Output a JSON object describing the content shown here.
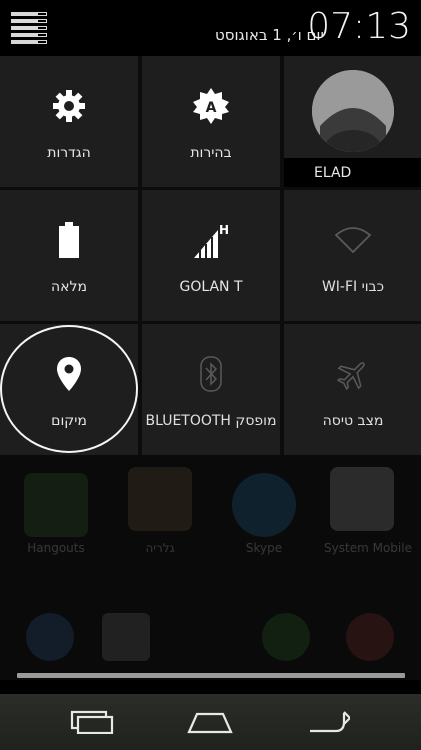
{
  "status": {
    "time": "07:13",
    "date": "יום ו׳, 1 באוגוסט"
  },
  "tiles": {
    "settings": {
      "label": "הגדרות",
      "icon": "gear-icon"
    },
    "brightness": {
      "label": "בהירות",
      "icon": "auto-brightness-icon"
    },
    "user": {
      "name": "ELAD",
      "icon": "avatar-icon"
    },
    "battery": {
      "label": "מלאה",
      "icon": "battery-icon"
    },
    "mobile": {
      "label": "GOLAN T",
      "icon": "signal-icon",
      "badge": "H"
    },
    "wifi": {
      "label": "WI-FI כבוי",
      "icon": "wifi-icon"
    },
    "location": {
      "label": "מיקום",
      "icon": "location-pin-icon"
    },
    "bluetooth": {
      "label": "BLUETOOTH מופסק",
      "icon": "bluetooth-icon"
    },
    "airplane": {
      "label": "מצב טיסה",
      "icon": "airplane-icon"
    }
  },
  "homescreen": {
    "apps": [
      {
        "label": "Hangouts"
      },
      {
        "label": "גלריה"
      },
      {
        "label": "Skype"
      },
      {
        "label": "System Mobile"
      }
    ]
  },
  "colors": {
    "tile_bg": "#1e1e1e",
    "icon_active": "#ffffff",
    "icon_inactive": "#5a5a5a"
  },
  "navbar": {
    "back": "back-icon",
    "home": "home-icon",
    "recents": "recent-apps-icon"
  }
}
